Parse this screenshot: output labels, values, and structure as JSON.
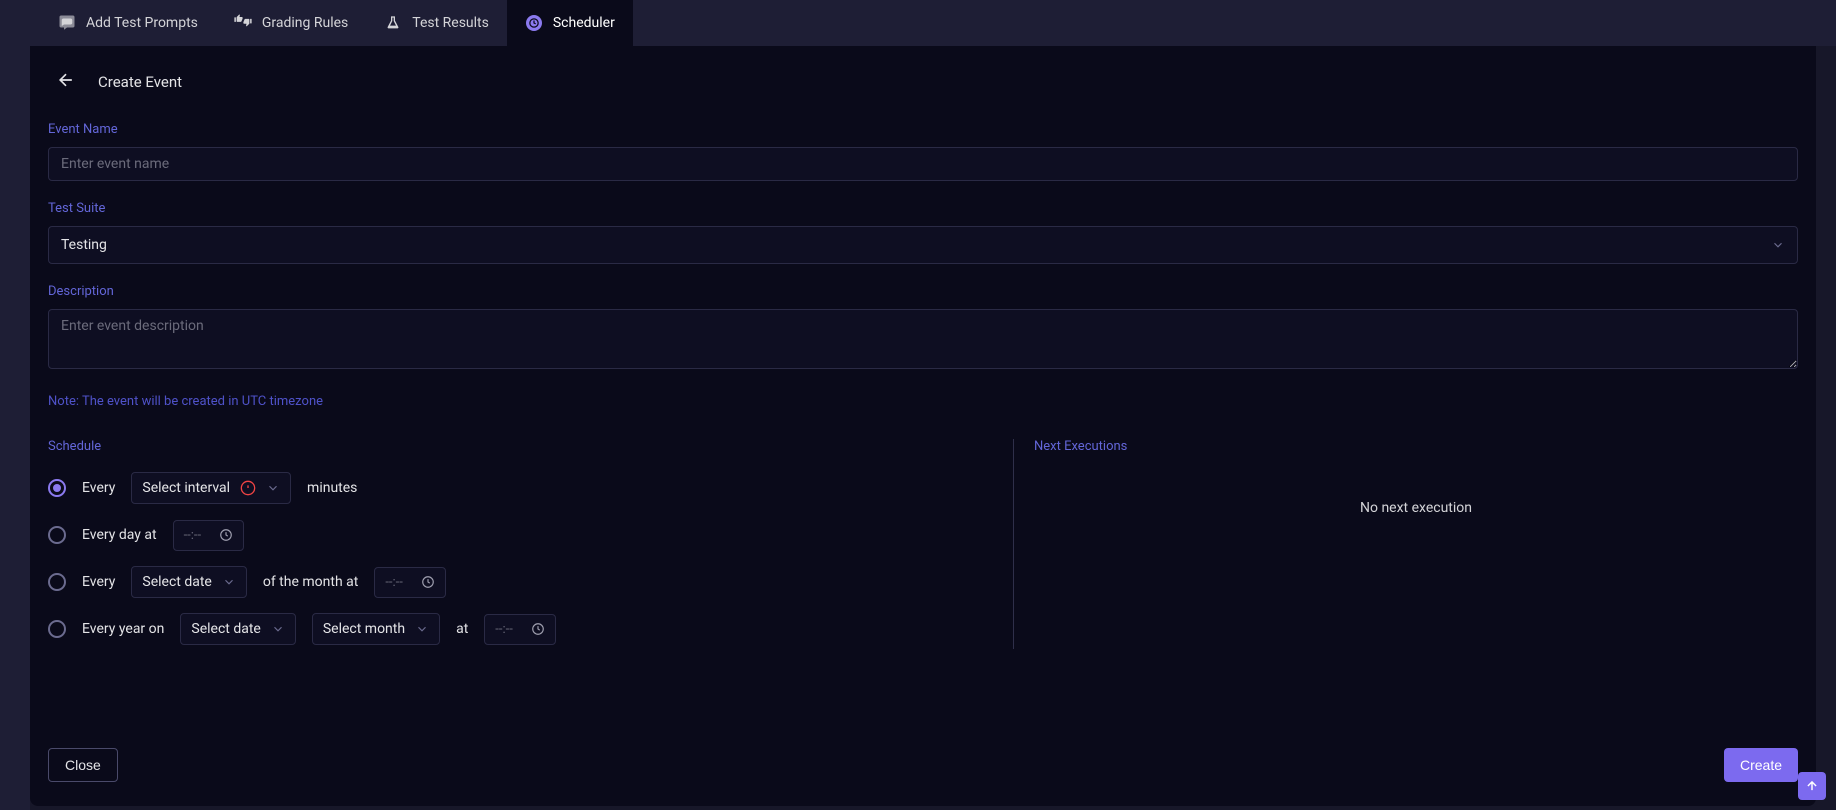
{
  "tabs": [
    {
      "label": "Add Test Prompts",
      "icon": "chat-icon"
    },
    {
      "label": "Grading Rules",
      "icon": "thumbs-icon"
    },
    {
      "label": "Test Results",
      "icon": "flask-icon"
    },
    {
      "label": "Scheduler",
      "icon": "clock-icon"
    }
  ],
  "header": {
    "title": "Create Event"
  },
  "form": {
    "event_name_label": "Event Name",
    "event_name_placeholder": "Enter event name",
    "event_name_value": "",
    "test_suite_label": "Test Suite",
    "test_suite_value": "Testing",
    "description_label": "Description",
    "description_placeholder": "Enter event description",
    "description_value": "",
    "note": "Note: The event will be created in UTC timezone"
  },
  "schedule": {
    "label": "Schedule",
    "options": {
      "interval": {
        "pre": "Every",
        "select": "Select interval",
        "post": "minutes"
      },
      "daily": {
        "text": "Every day at",
        "time": "--:--"
      },
      "monthly": {
        "pre": "Every",
        "select": "Select date",
        "mid": "of the month at",
        "time": "--:--"
      },
      "yearly": {
        "pre": "Every year on",
        "date_select": "Select date",
        "month_select": "Select month",
        "at": "at",
        "time": "--:--"
      }
    }
  },
  "next_exec": {
    "label": "Next Executions",
    "message": "No next execution"
  },
  "buttons": {
    "close": "Close",
    "create": "Create"
  }
}
